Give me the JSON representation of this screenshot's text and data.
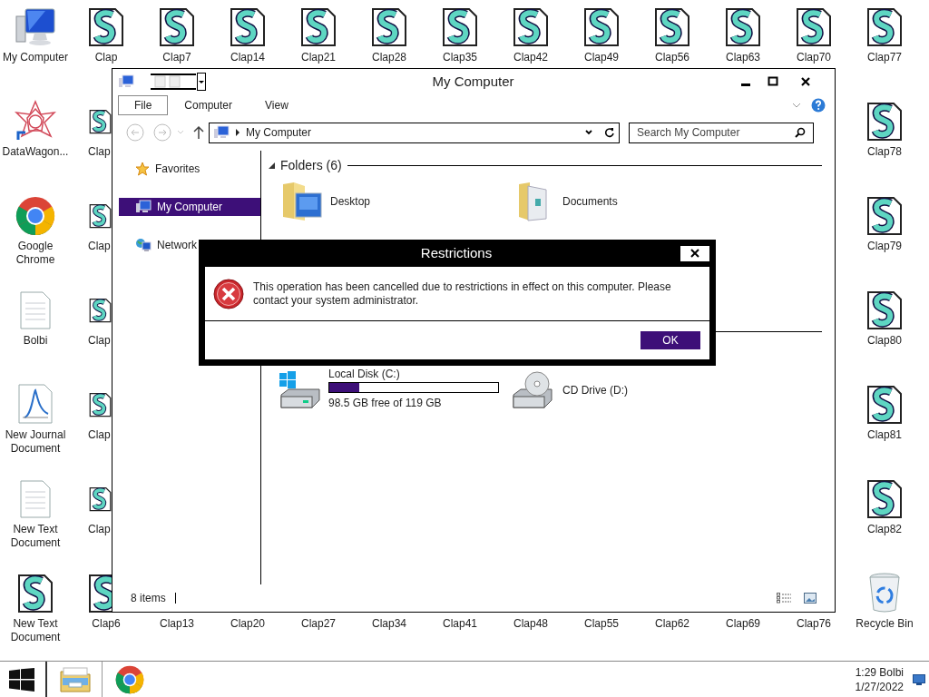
{
  "desktop": {
    "left_column": [
      {
        "label": "My Computer",
        "kind": "computer"
      },
      {
        "label": "DataWagon...",
        "kind": "star"
      },
      {
        "label": "Google Chrome",
        "kind": "chrome"
      },
      {
        "label": "Bolbi",
        "kind": "text"
      },
      {
        "label": "New Journal Document",
        "kind": "journal"
      },
      {
        "label": "New Text Document",
        "kind": "text"
      },
      {
        "label": "New Text Document",
        "kind": "clap"
      }
    ],
    "top_row": [
      {
        "label": "Clap",
        "kind": "clap"
      },
      {
        "label": "Clap7",
        "kind": "clap"
      },
      {
        "label": "Clap14",
        "kind": "clap"
      },
      {
        "label": "Clap21",
        "kind": "clap"
      },
      {
        "label": "Clap28",
        "kind": "clap"
      },
      {
        "label": "Clap35",
        "kind": "clap"
      },
      {
        "label": "Clap42",
        "kind": "clap"
      },
      {
        "label": "Clap49",
        "kind": "clap"
      },
      {
        "label": "Clap56",
        "kind": "clap"
      },
      {
        "label": "Clap63",
        "kind": "clap"
      },
      {
        "label": "Clap70",
        "kind": "clap"
      }
    ],
    "partly_hidden_column": [
      {
        "label": "Clap",
        "kind": "clap"
      },
      {
        "label": "Clap",
        "kind": "clap"
      },
      {
        "label": "Clap",
        "kind": "clap"
      },
      {
        "label": "Clap",
        "kind": "clap"
      },
      {
        "label": "Clap",
        "kind": "clap"
      }
    ],
    "bottom_row": [
      {
        "label": "Clap6",
        "kind": "clap"
      },
      {
        "label": "Clap13"
      },
      {
        "label": "Clap20"
      },
      {
        "label": "Clap27"
      },
      {
        "label": "Clap34"
      },
      {
        "label": "Clap41"
      },
      {
        "label": "Clap48"
      },
      {
        "label": "Clap55"
      },
      {
        "label": "Clap62"
      },
      {
        "label": "Clap69"
      },
      {
        "label": "Clap76"
      }
    ],
    "right_column": [
      {
        "label": "Clap77",
        "kind": "clap"
      },
      {
        "label": "Clap78",
        "kind": "clap"
      },
      {
        "label": "Clap79",
        "kind": "clap"
      },
      {
        "label": "Clap80",
        "kind": "clap"
      },
      {
        "label": "Clap81",
        "kind": "clap"
      },
      {
        "label": "Clap82",
        "kind": "clap"
      },
      {
        "label": "Recycle Bin",
        "kind": "recycle"
      }
    ]
  },
  "window": {
    "title": "My Computer",
    "ribbon_tabs": [
      {
        "label": "File",
        "selected": true
      },
      {
        "label": "Computer",
        "selected": false
      },
      {
        "label": "View",
        "selected": false
      }
    ],
    "address": "My Computer",
    "search": {
      "placeholder": "Search My Computer"
    },
    "nav": [
      {
        "label": "Favorites",
        "kind": "star",
        "selected": false
      },
      {
        "label": "My Computer",
        "kind": "computer",
        "selected": true
      },
      {
        "label": "Network",
        "kind": "network",
        "selected": false
      }
    ],
    "folders_header": "Folders (6)",
    "folders": [
      {
        "name": "Desktop",
        "kind": "desktop"
      },
      {
        "name": "Documents",
        "kind": "documents"
      }
    ],
    "drives": [
      {
        "name": "Local Disk (C:)",
        "kind": "disk",
        "level": 0.18,
        "free": "98.5 GB free of 119 GB"
      },
      {
        "name": "CD Drive (D:)",
        "kind": "cd"
      }
    ],
    "status": "8 items"
  },
  "dialog": {
    "title": "Restrictions",
    "message": "This operation has been cancelled due to restrictions in effect on this computer. Please contact your system administrator.",
    "button": "OK"
  },
  "taskbar": {
    "time": "1:29 Bolbi",
    "date": "1/27/2022"
  }
}
